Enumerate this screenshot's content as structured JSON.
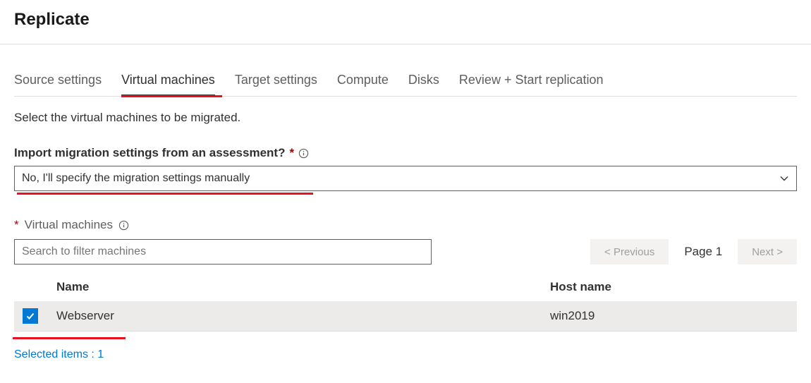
{
  "header": {
    "title": "Replicate"
  },
  "tabs": {
    "items": [
      {
        "label": "Source settings"
      },
      {
        "label": "Virtual machines"
      },
      {
        "label": "Target settings"
      },
      {
        "label": "Compute"
      },
      {
        "label": "Disks"
      },
      {
        "label": "Review + Start replication"
      }
    ],
    "active_index": 1
  },
  "instruction": "Select the virtual machines to be migrated.",
  "import_field": {
    "label": "Import migration settings from an assessment?",
    "value": "No, I'll specify the migration settings manually"
  },
  "vm_section": {
    "label": "Virtual machines",
    "search_placeholder": "Search to filter machines",
    "prev_label": "< Previous",
    "page_text": "Page 1",
    "next_label": "Next >",
    "columns": {
      "name": "Name",
      "host": "Host name"
    },
    "rows": [
      {
        "checked": true,
        "name": "Webserver",
        "host": "win2019"
      }
    ],
    "selected_text": "Selected items : 1"
  }
}
